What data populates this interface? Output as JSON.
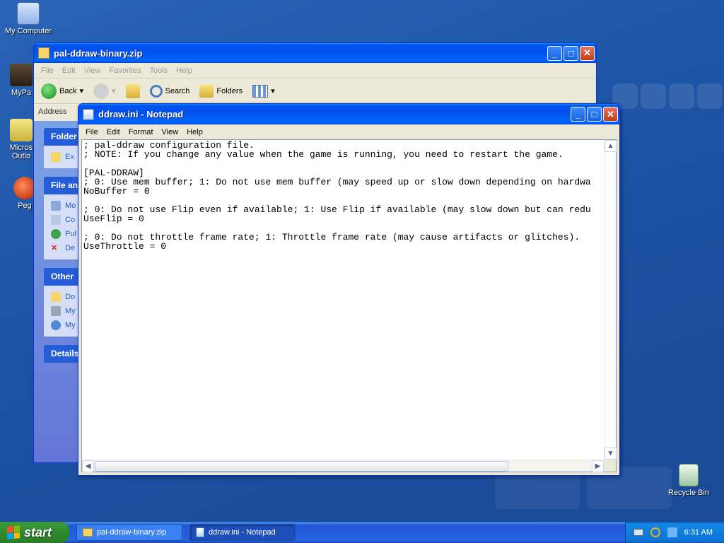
{
  "desktop": {
    "icons": [
      {
        "label": "My Computer"
      },
      {
        "label": "MyPa"
      },
      {
        "label": "Micros Outlo"
      },
      {
        "label": "Peg"
      },
      {
        "label": "Recycle Bin"
      }
    ]
  },
  "explorer": {
    "title": "pal-ddraw-binary.zip",
    "menu": [
      "File",
      "Edit",
      "View",
      "Favorites",
      "Tools",
      "Help"
    ],
    "toolbar": {
      "back": "Back",
      "search": "Search",
      "folders": "Folders"
    },
    "address_label": "Address",
    "panels": [
      {
        "title": "Folder",
        "items": [
          "Ex"
        ]
      },
      {
        "title": "File an",
        "items": [
          "Mo",
          "Co",
          "Pul",
          "De"
        ]
      },
      {
        "title": "Other",
        "items": [
          "Do",
          "My",
          "My"
        ]
      },
      {
        "title": "Details",
        "items": []
      }
    ]
  },
  "notepad": {
    "title": "ddraw.ini - Notepad",
    "menu": [
      "File",
      "Edit",
      "Format",
      "View",
      "Help"
    ],
    "content": "; pal-ddraw configuration file.\n; NOTE: If you change any value when the game is running, you need to restart the game.\n\n[PAL-DDRAW]\n; 0: Use mem buffer; 1: Do not use mem buffer (may speed up or slow down depending on hardwa\nNoBuffer = 0\n\n; 0: Do not use Flip even if available; 1: Use Flip if available (may slow down but can redu\nUseFlip = 0\n\n; 0: Do not throttle frame rate; 1: Throttle frame rate (may cause artifacts or glitches).\nUseThrottle = 0"
  },
  "taskbar": {
    "start_label": "start",
    "tasks": [
      {
        "label": "pal-ddraw-binary.zip"
      },
      {
        "label": "ddraw.ini - Notepad"
      }
    ],
    "clock": "6:31 AM"
  }
}
